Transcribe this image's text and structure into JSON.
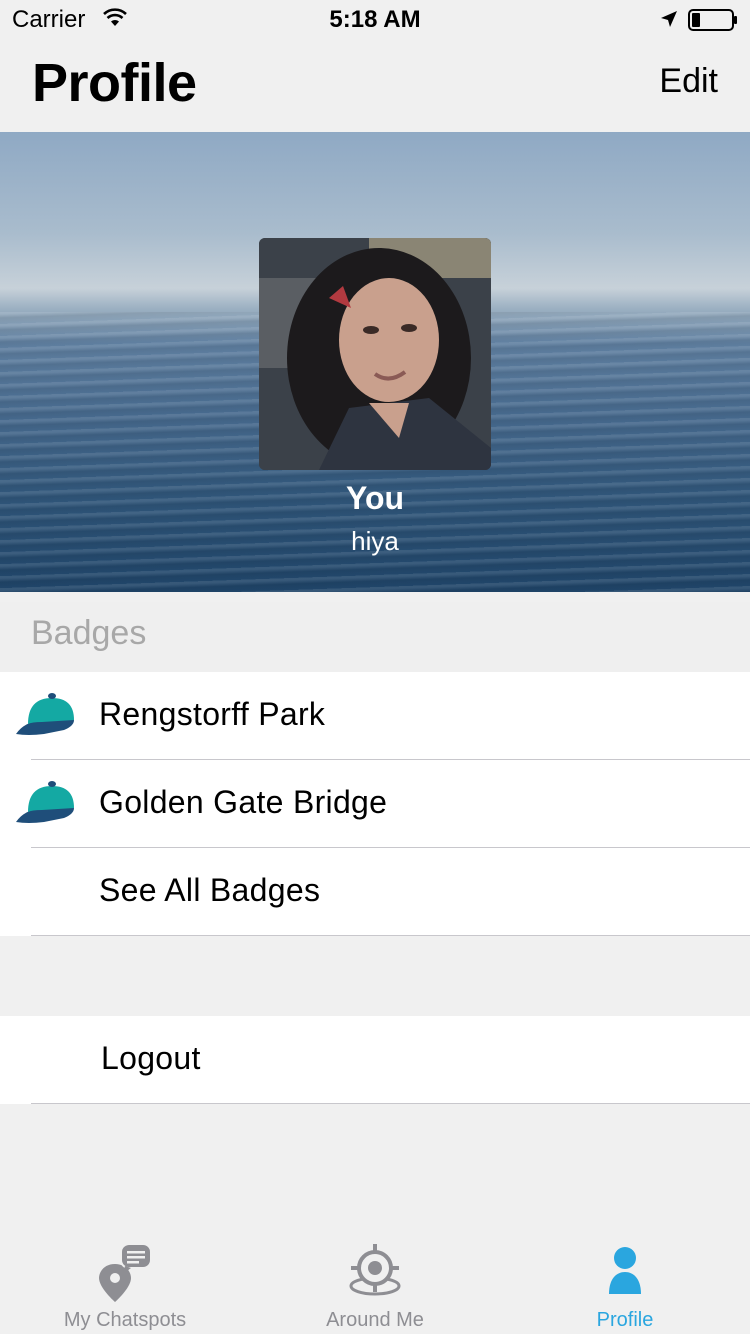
{
  "status_bar": {
    "carrier": "Carrier",
    "time": "5:18 AM",
    "icons": [
      "wifi-icon",
      "location-arrow-icon",
      "battery-icon"
    ]
  },
  "header": {
    "title": "Profile",
    "edit_label": "Edit"
  },
  "profile": {
    "name": "You",
    "status": "hiya"
  },
  "badges": {
    "section_title": "Badges",
    "items": [
      {
        "label": "Rengstorff Park",
        "icon": "cap-icon"
      },
      {
        "label": "Golden Gate Bridge",
        "icon": "cap-icon"
      }
    ],
    "see_all_label": "See All Badges"
  },
  "account": {
    "logout_label": "Logout"
  },
  "tab_bar": {
    "tabs": [
      {
        "label": "My Chatspots",
        "icon": "chat-pin-icon",
        "active": false
      },
      {
        "label": "Around Me",
        "icon": "target-icon",
        "active": false
      },
      {
        "label": "Profile",
        "icon": "person-icon",
        "active": true
      }
    ]
  },
  "colors": {
    "accent": "#2aa6df",
    "cap_primary": "#14a9a3",
    "cap_brim": "#1f4e7a",
    "inactive_icon": "#8e8e93"
  }
}
